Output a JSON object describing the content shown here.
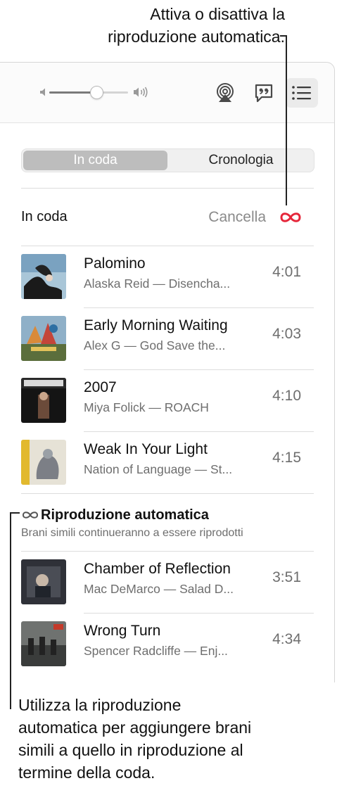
{
  "callouts": {
    "top_line1": "Attiva o disattiva la",
    "top_line2": "riproduzione automatica.",
    "bottom_line1": "Utilizza la riproduzione",
    "bottom_line2": "automatica per aggiungere brani",
    "bottom_line3": "simili a quello in riproduzione al",
    "bottom_line4": "termine della coda."
  },
  "toolbar": {
    "volume_level": 0.6,
    "icons": [
      "speaker-low-icon",
      "speaker-high-icon",
      "airplay-icon",
      "lyrics-icon",
      "queue-list-icon"
    ]
  },
  "tabs": {
    "queue": "In coda",
    "history": "Cronologia"
  },
  "queue": {
    "title": "In coda",
    "clear": "Cancella",
    "tracks": [
      {
        "title": "Palomino",
        "subtitle": "Alaska Reid — Disencha...",
        "duration": "4:01"
      },
      {
        "title": "Early Morning Waiting",
        "subtitle": "Alex G — God Save the...",
        "duration": "4:03"
      },
      {
        "title": "2007",
        "subtitle": "Miya Folick — ROACH",
        "duration": "4:10"
      },
      {
        "title": "Weak In Your Light",
        "subtitle": "Nation of Language — St...",
        "duration": "4:15"
      }
    ]
  },
  "autoplay": {
    "title": "Riproduzione automatica",
    "subtitle": "Brani simili continueranno a essere riprodotti",
    "tracks": [
      {
        "title": "Chamber of Reflection",
        "subtitle": "Mac DeMarco — Salad D...",
        "duration": "3:51"
      },
      {
        "title": "Wrong Turn",
        "subtitle": "Spencer Radcliffe — Enj...",
        "duration": "4:34"
      }
    ]
  },
  "colors": {
    "accent": "#e5263a",
    "secondary_text": "#6e6e6e"
  }
}
